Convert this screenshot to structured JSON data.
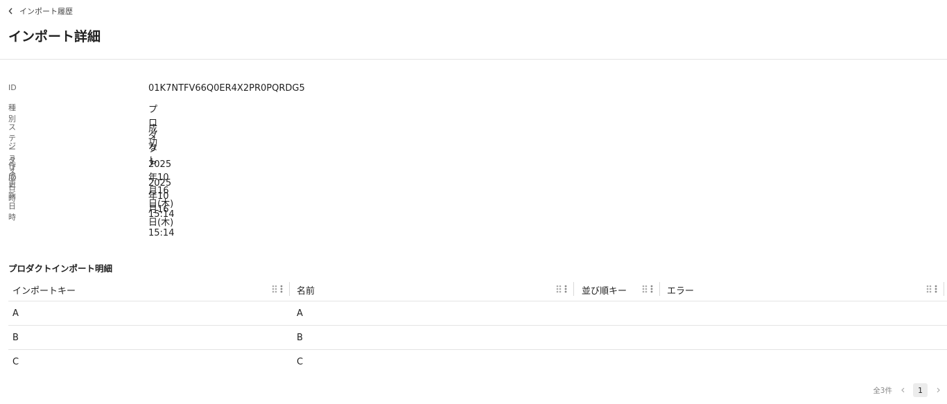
{
  "breadcrumb": {
    "back_label": "インポート履歴"
  },
  "page": {
    "title": "インポート詳細"
  },
  "details": [
    {
      "label": "ID",
      "value": "01K7NTFV66Q0ER4X2PR0PQRDG5"
    },
    {
      "label": "種別",
      "value": "プロダクト"
    },
    {
      "label": "ステータス",
      "value": "成功"
    },
    {
      "label": "ジョブID",
      "value": "なし"
    },
    {
      "label": "作成日時",
      "value": "2025年10月16日(木) 15:14"
    },
    {
      "label": "更新日時",
      "value": "2025年10月16日(木) 15:14"
    }
  ],
  "table": {
    "title": "プロダクトインポート明細",
    "columns": [
      {
        "label": "インポートキー"
      },
      {
        "label": "名前"
      },
      {
        "label": "並び順キー"
      },
      {
        "label": "エラー"
      }
    ],
    "rows": [
      [
        "A",
        "A",
        "",
        ""
      ],
      [
        "B",
        "B",
        "",
        ""
      ],
      [
        "C",
        "C",
        "",
        ""
      ]
    ]
  },
  "pagination": {
    "total": "全3件",
    "current_page": "1"
  },
  "icons": {
    "back": "chevron-left-icon",
    "drag": "drag-handle-icon",
    "menu": "more-vertical-icon",
    "prev": "chevron-left-icon",
    "next": "chevron-right-icon"
  }
}
